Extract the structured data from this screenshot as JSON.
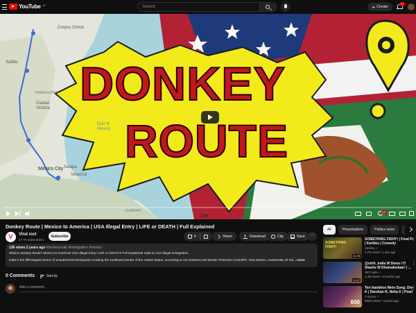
{
  "header": {
    "logo_text": "YouTube",
    "logo_sup": "IN",
    "search_placeholder": "Search",
    "create_label": "Create",
    "notification_count": "9+"
  },
  "player": {
    "overlay_line1": "DONKEY",
    "overlay_line2": "ROUTE",
    "progress": 0.0,
    "map_labels": [
      "Corpus Christi",
      "Saltillo",
      "TAMAULIPAS",
      "Ciudad Victoria",
      "Mexico City",
      "Xalapa",
      "Veracruz",
      "Gulf of Mexico",
      "CHIAPAS",
      "lize"
    ]
  },
  "video": {
    "title": "Donkey Route | Mexico to America | USA Illegal Entry | LIFE or DEATH | Full Explained",
    "channel_name": "Viral rocl",
    "subscribers": "17.7K subscribers",
    "subscribe_label": "Subscribe",
    "likes": "6",
    "share_label": "Share",
    "download_label": "Download",
    "clip_label": "Clip",
    "save_label": "Save",
    "more_label": "···"
  },
  "description": {
    "meta_bold": "136 views  2 years ago",
    "tags": " #donkeyroute #immigration #mexico",
    "line1": "What is Donkey Route?  Mexico to America!! USA Illegal Entry! LIFE or DEATH!! Full Explained! India to USA illegal Immigration.",
    "line2": "India is the fifth-largest source of unauthorized immigrants crossing the southwest border of the United States, according to US Customs and Border Protection (USCBP). Only Mexico, Guatemala, El Sal",
    "more": "...more"
  },
  "comments": {
    "heading": "0 Comments",
    "sort_label": "Sort by",
    "add_placeholder": "Add a comment..."
  },
  "chips": [
    "All",
    "Presentations",
    "Politics news",
    "Related"
  ],
  "recommendations": [
    {
      "title1": "SOMETHING FISHY! | Final Part",
      "title2": "| Karikku | Comedy",
      "channel": "Karikku ✓",
      "meta": "3.7M views • 1 day ago",
      "duration": "31:38",
      "thumb_label": "SOMETHING FISHY!"
    },
    {
      "title1": "@sirth_india W Demo !!!!",
      "title2": "Sharks W Dhamakedaar! | ...",
      "channel": "SET India ✓",
      "meta": "1.4M views • 3 months ago",
      "duration": "11:47",
      "thumb_label": ""
    },
    {
      "title1": "Teri Aankhon Mein Song: Divya",
      "title2": "K | Darshan R, Neha K | Pearl V...",
      "channel": "T-Series ✓",
      "meta": "982M views • 4 years ago",
      "duration": "",
      "thumb_label": "600"
    }
  ],
  "colors": {
    "background": "#0f0f0f",
    "brand_red": "#ff0000",
    "overlay_text": "#c0181b",
    "overlay_yellow": "#f2ea1b"
  }
}
